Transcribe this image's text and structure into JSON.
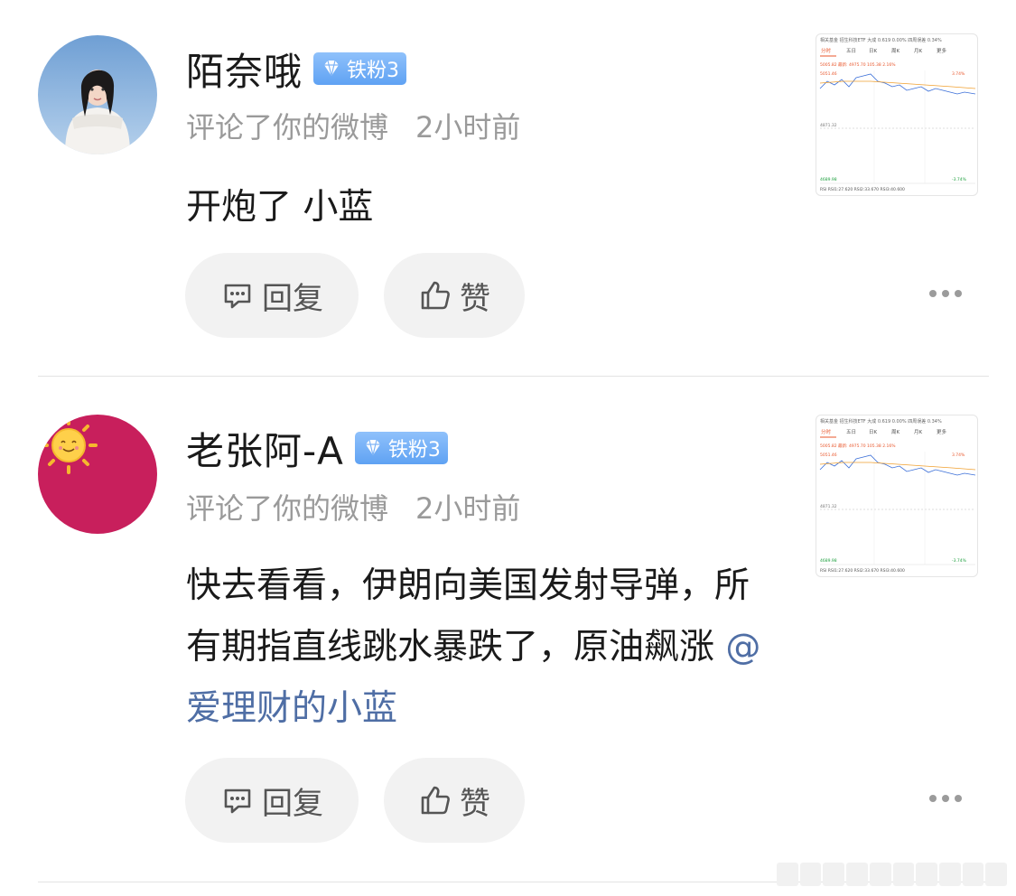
{
  "comments": [
    {
      "username": "陌奈哦",
      "badge": "铁粉3",
      "action": "评论了你的微博",
      "time": "2小时前",
      "content": "开炮了 小蓝",
      "mention": "",
      "reply_label": "回复",
      "like_label": "赞",
      "avatar": "photo-woman-in-white-sweater",
      "thumbnail": {
        "top_line": "相关基金  招生科技ETF 大成 0.619 0.00%   四周误差  0.34%",
        "tabs": [
          "分时",
          "五日",
          "日K",
          "周K",
          "月K",
          "更多"
        ],
        "price_line": "5005.82  最新: 4975.70  105.38  2.16%",
        "high_label": "5051.46",
        "mid_label": "4871.32",
        "low_label": "4689.98",
        "high_pct": "3.74%",
        "low_pct": "-3.74%",
        "rsi_line": "RSI   RSI1:27.620  RSI2:33.670  RSI3:40.600"
      }
    },
    {
      "username": "老张阿-A",
      "badge": "铁粉3",
      "action": "评论了你的微博",
      "time": "2小时前",
      "content": "快去看看，伊朗向美国发射导弹，所有期指直线跳水暴跌了，原油飙涨 ",
      "mention": "@爱理财的小蓝",
      "reply_label": "回复",
      "like_label": "赞",
      "avatar": "sun-emoji-on-magenta",
      "thumbnail": {
        "top_line": "相关基金  招生科技ETF 大成 0.619 0.00%   四周误差  0.34%",
        "tabs": [
          "分时",
          "五日",
          "日K",
          "周K",
          "月K",
          "更多"
        ],
        "price_line": "5005.82  最新: 4975.70  105.38  2.16%",
        "high_label": "5051.46",
        "mid_label": "4871.32",
        "low_label": "4689.98",
        "high_pct": "3.74%",
        "low_pct": "-3.74%",
        "rsi_line": "RSI   RSI1:27.620  RSI2:33.670  RSI3:40.600"
      }
    }
  ],
  "colors": {
    "badge": "#6aaaf5",
    "mention": "#4f6ea5",
    "meta": "#9a9a9a",
    "pill_bg": "#f2f2f2",
    "avatar2_bg": "#c81f5c"
  }
}
